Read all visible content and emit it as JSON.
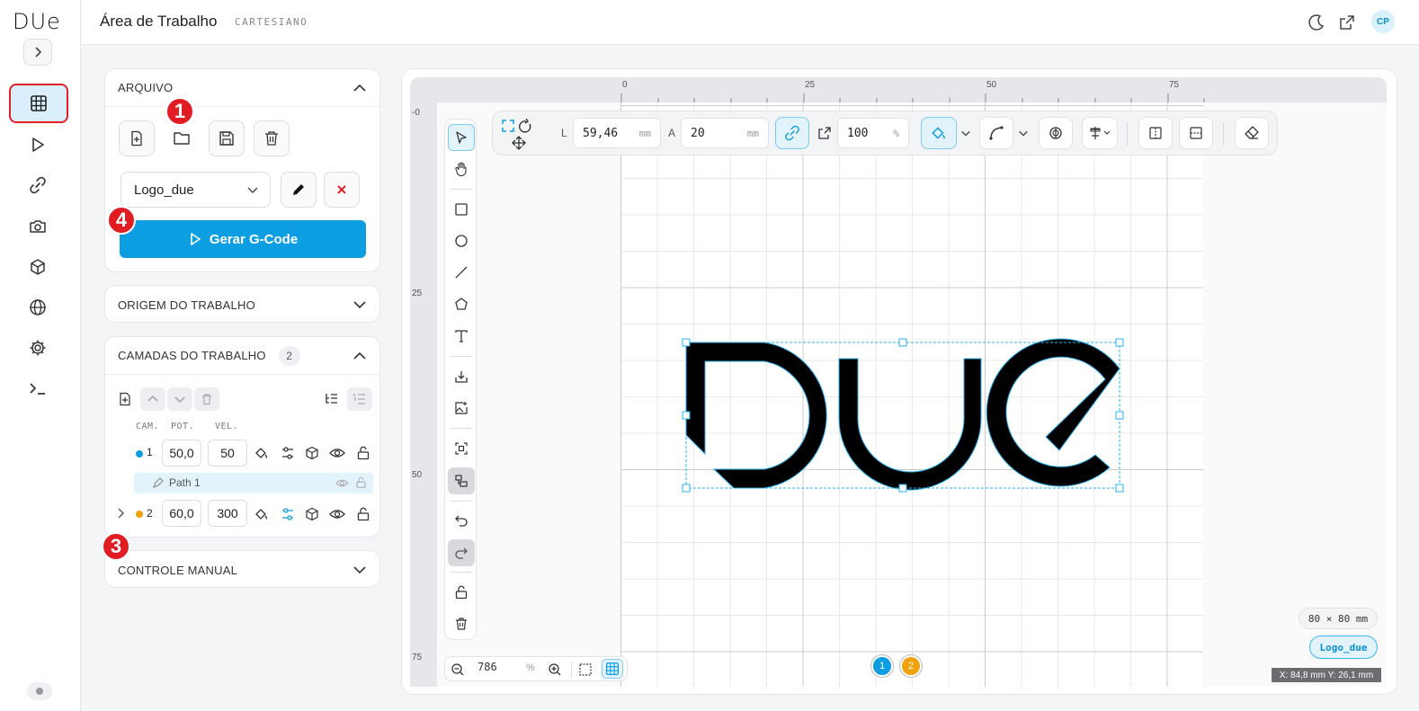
{
  "app": {
    "logo": "DUe"
  },
  "topbar": {
    "title": "Área de Trabalho",
    "subtitle": "CARTESIANO",
    "avatar": "CP"
  },
  "sidebar": {
    "items": [
      "grid",
      "play",
      "link",
      "camera",
      "cube",
      "globe",
      "gear",
      "terminal"
    ],
    "active": "grid"
  },
  "arquivo": {
    "header": "ARQUIVO",
    "project_select": "Logo_due",
    "gcode_button": "Gerar G-Code"
  },
  "origem": {
    "header": "ORIGEM DO TRABALHO"
  },
  "camadas": {
    "header": "CAMADAS DO TRABALHO",
    "count": "2",
    "col_cam": "CAM.",
    "col_pot": "POT.",
    "col_vel": "VEL.",
    "layers": [
      {
        "num": "1",
        "pot": "50,0",
        "vel": "50",
        "color": "#0c9ee1"
      },
      {
        "num": "2",
        "pot": "60,0",
        "vel": "300",
        "color": "#f2a20c"
      }
    ],
    "path_label": "Path 1"
  },
  "controle": {
    "header": "CONTROLE MANUAL"
  },
  "callouts": [
    "1",
    "2",
    "3",
    "4"
  ],
  "rulers": {
    "top": [
      "0",
      "25",
      "50",
      "75"
    ],
    "left": [
      "-0",
      "25",
      "50",
      "75"
    ]
  },
  "props": {
    "l_label": "L",
    "l_value": "59,46",
    "l_unit": "mm",
    "a_label": "A",
    "a_value": "20",
    "a_unit": "mm",
    "scale_value": "100",
    "scale_unit": "%"
  },
  "zoom": {
    "value": "786",
    "unit": "%"
  },
  "layer_badges": [
    {
      "label": "1",
      "color": "#0c9ee1"
    },
    {
      "label": "2",
      "color": "#f2a20c"
    }
  ],
  "canvas": {
    "dims": "80 × 80 mm",
    "file": "Logo_due",
    "coords": "X: 84,8 mm  Y: 26,1 mm"
  },
  "colors": {
    "accent": "#0c9ee1",
    "callout": "#e11d23",
    "layer2": "#f2a20c"
  }
}
